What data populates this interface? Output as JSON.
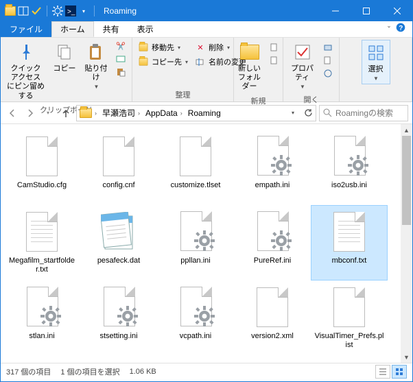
{
  "title": "Roaming",
  "menu": {
    "file": "ファイル",
    "home": "ホーム",
    "share": "共有",
    "view": "表示"
  },
  "ribbon": {
    "pin": "クイック アクセス\nにピン留めする",
    "copy": "コピー",
    "paste": "貼り付け",
    "clipboard_label": "クリップボード",
    "moveto": "移動先",
    "copyto": "コピー先",
    "delete": "削除",
    "rename": "名前の変更",
    "organize_label": "整理",
    "newfolder": "新しい\nフォルダー",
    "new_label": "新規",
    "properties": "プロパティ",
    "open_label": "開く",
    "select": "選択",
    "select_label": ""
  },
  "breadcrumb": {
    "b1": "早瀬浩司",
    "b2": "AppData",
    "b3": "Roaming"
  },
  "search_placeholder": "Roamingの検索",
  "files": {
    "f0": "CamStudio.cfg",
    "f1": "config.cnf",
    "f2": "customize.tlset",
    "f3": "empath.ini",
    "f4": "iso2usb.ini",
    "f5": "Megafilm_startfolder.txt",
    "f6": "pesafeck.dat",
    "f7": "ppllan.ini",
    "f8": "PureRef.ini",
    "f9": "mbconf.txt",
    "f10": "stlan.ini",
    "f11": "stsetting.ini",
    "f12": "vcpath.ini",
    "f13": "version2.xml",
    "f14": "VisualTimer_Prefs.plist"
  },
  "status": {
    "count": "317 個の項目",
    "selected": "1 個の項目を選択",
    "size": "1.06 KB"
  }
}
